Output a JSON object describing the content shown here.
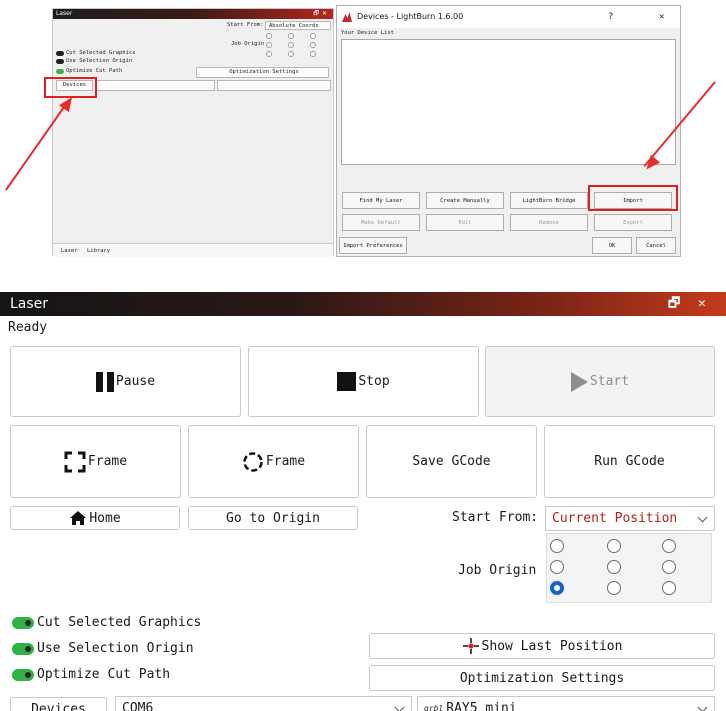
{
  "top_laser": {
    "title": "Laser",
    "start_from_label": "Start From:",
    "start_from_value": "Absolute Coords",
    "job_origin_label": "Job Origin",
    "cut_selected": "Cut Selected Graphics",
    "use_selection_origin": "Use Selection Origin",
    "optimize_cut_path": "Optimize Cut Path",
    "optimization_settings": "Optimization Settings",
    "devices": "Devices",
    "tab_laser": "Laser",
    "tab_library": "Library"
  },
  "devices_dialog": {
    "title": "Devices - LightBurn 1.6.00",
    "help": "?",
    "close": "✕",
    "list_label": "Your Device List",
    "buttons": [
      "Find My Laser",
      "Create Manually",
      "LightBurn Bridge",
      "Import"
    ],
    "disabled_buttons": [
      "Make Default",
      "Edit",
      "Remove",
      "Export"
    ],
    "import_prefs": "Import Preferences",
    "ok": "OK",
    "cancel": "Cancel"
  },
  "laser": {
    "title": "Laser",
    "status": "Ready",
    "pause": "Pause",
    "stop": "Stop",
    "start": "Start",
    "frame1": "Frame",
    "frame2": "Frame",
    "save_gcode": "Save GCode",
    "run_gcode": "Run GCode",
    "home": "Home",
    "go_to_origin": "Go to Origin",
    "start_from_label": "Start From:",
    "start_from_value": "Current Position",
    "job_origin_label": "Job Origin",
    "cut_selected": "Cut Selected Graphics",
    "use_selection_origin": "Use Selection Origin",
    "optimize_cut_path": "Optimize Cut Path",
    "show_last_position": "Show Last Position",
    "optimization_settings": "Optimization Settings",
    "devices": "Devices",
    "port": "COM6",
    "device_badge": "grbl",
    "device_name": "RAY5 mini",
    "selected_origin": "bottom-left"
  },
  "colors": {
    "highlight": "#e02020",
    "toggle_on": "#2fb344",
    "radio_selected": "#1464c8"
  }
}
